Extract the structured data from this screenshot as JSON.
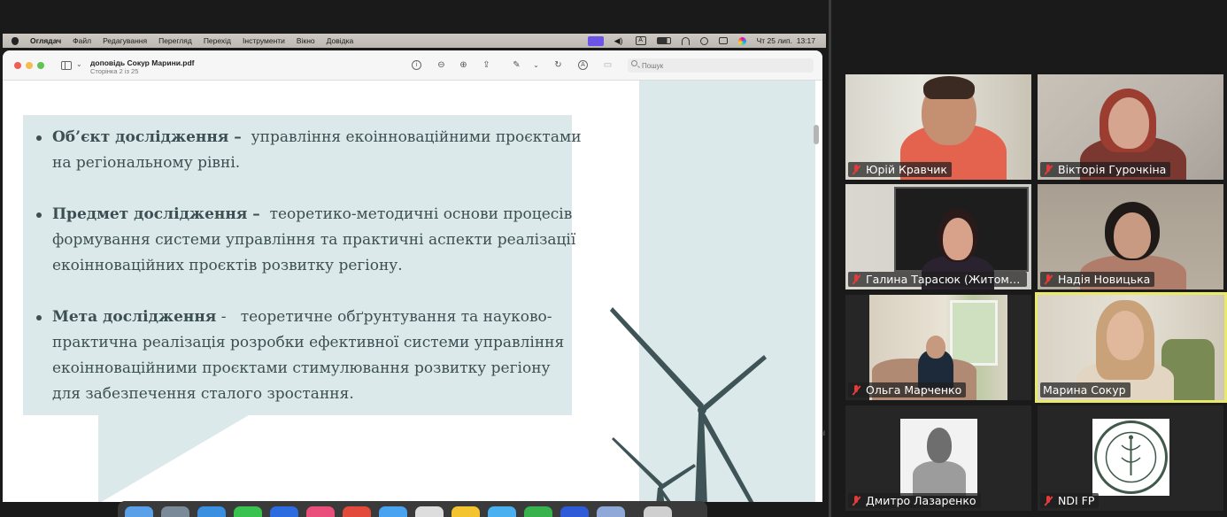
{
  "menubar": {
    "app": "Оглядач",
    "items": [
      "Файл",
      "Редагування",
      "Перегляд",
      "Перехід",
      "Інструменти",
      "Вікно",
      "Довідка"
    ],
    "clock": "Чт 25 лип.  13:17",
    "input_letter": "A"
  },
  "preview": {
    "doc_title": "доповідь Сокур Марини.pdf",
    "doc_pages": "Сторінка 2 із 25",
    "search_placeholder": "Пошук"
  },
  "slide": {
    "bullets": [
      {
        "term": "Об’єкт дослідження –",
        "lines": [
          "управління екоінноваційними проєктами",
          "на регіональному рівні."
        ]
      },
      {
        "term": "Предмет дослідження –",
        "lines": [
          "теоретико-методичні основи процесів",
          "формування системи управління та практичні аспекти реалізації",
          "екоінноваційних проєктів розвитку регіону."
        ]
      },
      {
        "term": "Мета дослідження",
        "sep": "-",
        "lines": [
          "теоретичне обґрунтування та науково-",
          "практична реалізація розробки ефективної системи управління",
          "екоінноваційними проєктами стимулювання розвитку регіону",
          "для забезпечення сталого зростання."
        ]
      }
    ],
    "accent_color": "#dce9ea",
    "text_color": "#3c4f52"
  },
  "participants": [
    {
      "name": "Юрій Кравчик",
      "muted": true
    },
    {
      "name": "Вікторія Гурочкіна",
      "muted": true
    },
    {
      "name": "Галина Тарасюк (Житомир...",
      "muted": true
    },
    {
      "name": "Надія Новицька",
      "muted": true
    },
    {
      "name": "Ольга Марченко",
      "muted": true
    },
    {
      "name": "Марина Сокур",
      "muted": false,
      "active_speaker": true
    },
    {
      "name": "Дмитро Лазаренко",
      "muted": true
    },
    {
      "name": "NDI FP",
      "muted": true
    }
  ],
  "active_speaker_color": "#e9e96a",
  "edge_mark": "ıl"
}
